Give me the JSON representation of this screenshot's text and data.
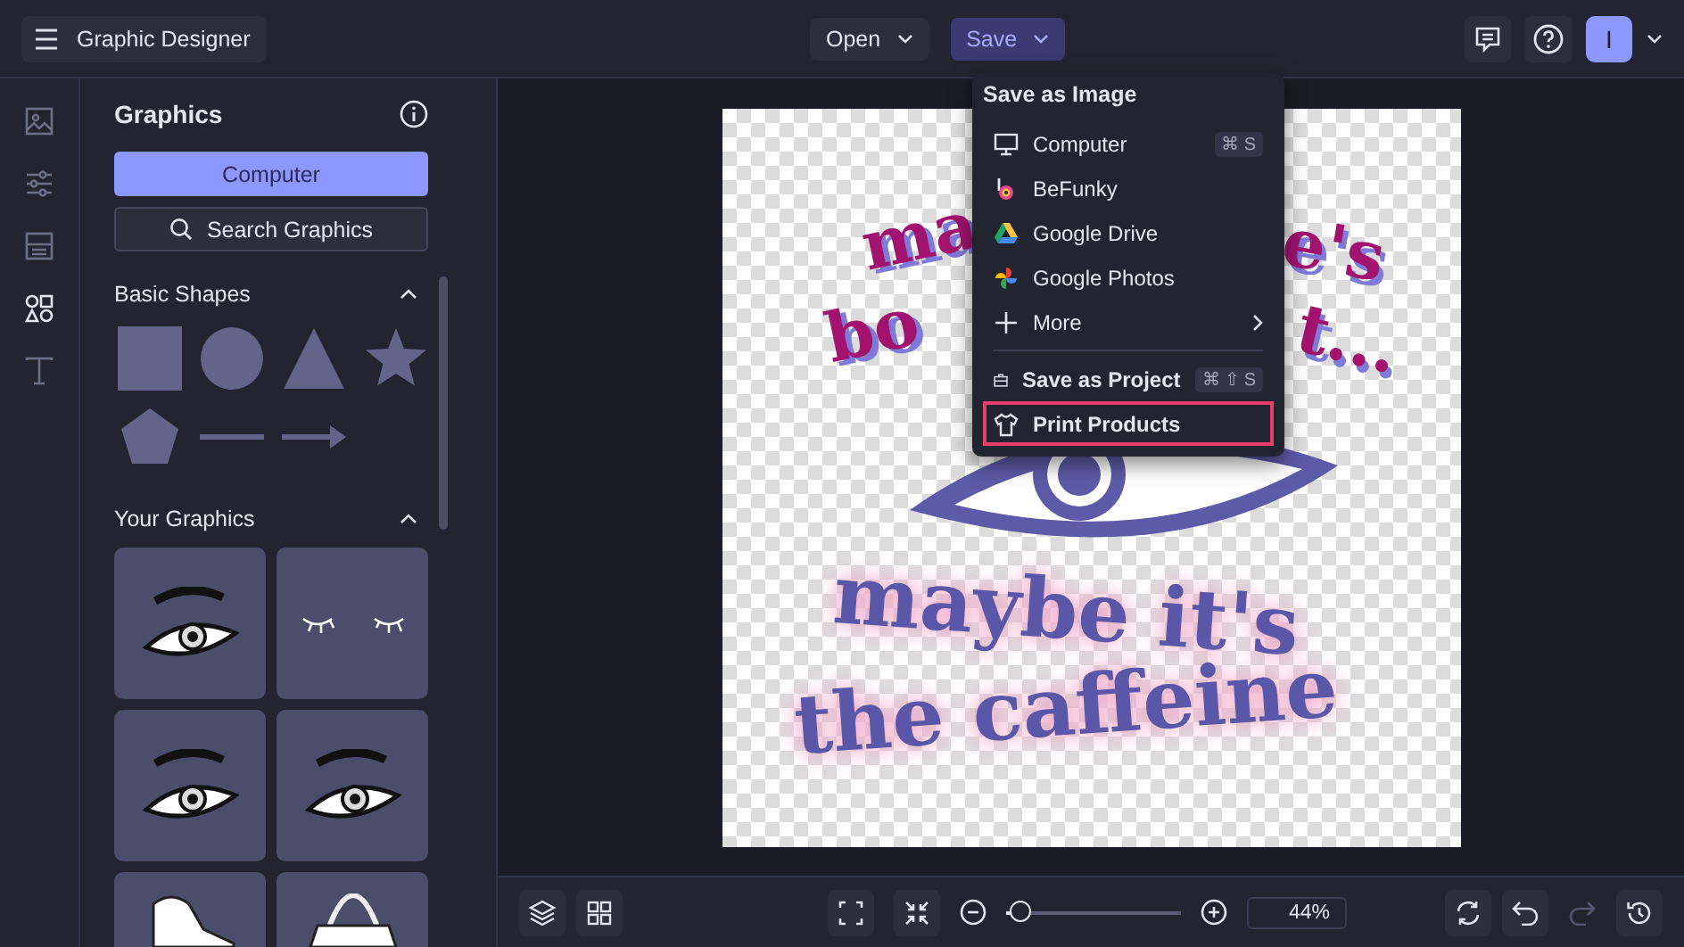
{
  "app_menu": {
    "label": "Graphic Designer"
  },
  "file_buttons": [
    {
      "label": "Open",
      "selected": false
    },
    {
      "label": "Save",
      "selected": true
    }
  ],
  "user": {
    "initial": "I"
  },
  "rail": [
    {
      "kind": "photo",
      "selected": false
    },
    {
      "kind": "adjust",
      "selected": false
    },
    {
      "kind": "layout",
      "selected": false
    },
    {
      "kind": "graphics",
      "selected": true
    },
    {
      "kind": "text",
      "selected": false
    }
  ],
  "panel": {
    "title": "Graphics",
    "primary_button": "Computer",
    "search_button": "Search Graphics",
    "sections": [
      {
        "title": "Basic Shapes",
        "expanded": true,
        "kind": "shapes"
      },
      {
        "title": "Your Graphics",
        "expanded": true,
        "kind": "graphics"
      }
    ]
  },
  "menu": {
    "heading": "Save as Image",
    "items": [
      {
        "label": "Computer",
        "kind": "computer",
        "shortcut": "⌘ S",
        "bold": false,
        "highlighted": false,
        "divider_before": false
      },
      {
        "label": "BeFunky",
        "kind": "befunky",
        "bold": false,
        "highlighted": false,
        "divider_before": false
      },
      {
        "label": "Google Drive",
        "kind": "drive",
        "bold": false,
        "highlighted": false,
        "divider_before": false
      },
      {
        "label": "Google Photos",
        "kind": "photos",
        "bold": false,
        "highlighted": false,
        "divider_before": false
      },
      {
        "label": "More",
        "kind": "more",
        "bold": false,
        "highlighted": false,
        "divider_before": false
      },
      {
        "label": "Save as Project",
        "kind": "project",
        "shortcut": "⌘ ⇧ S",
        "bold": true,
        "highlighted": false,
        "divider_before": true
      },
      {
        "label": "Print Products",
        "kind": "print",
        "bold": true,
        "highlighted": true,
        "divider_before": false
      }
    ]
  },
  "design": {
    "texts": [
      {
        "text": "ma",
        "kind": "headline"
      },
      {
        "text": "e's",
        "kind": "headline"
      },
      {
        "text": "bo",
        "kind": "headline"
      },
      {
        "text": "t...",
        "kind": "headline"
      },
      {
        "text": "maybe it's",
        "kind": "tagline"
      },
      {
        "text": "the caffeine",
        "kind": "tagline"
      }
    ]
  },
  "zoom": {
    "level": 0.08,
    "reading": "44%"
  },
  "redo": {
    "disabled": true
  }
}
